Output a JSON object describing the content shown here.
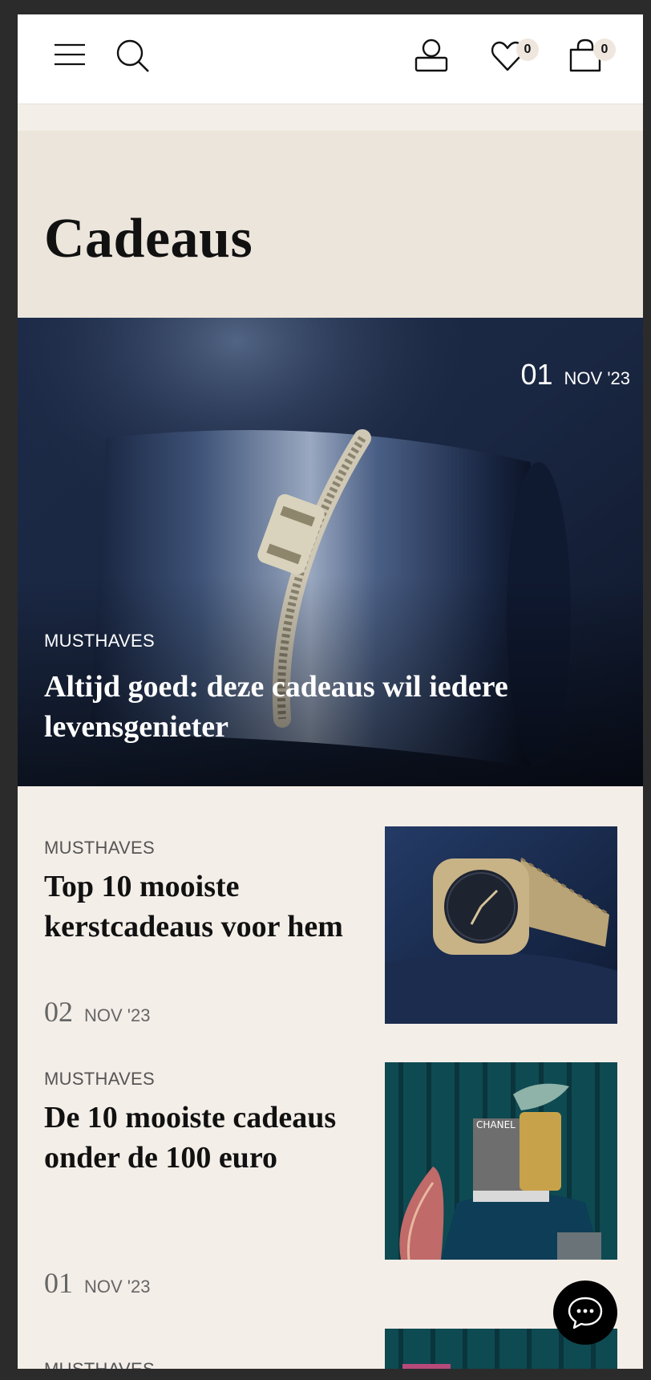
{
  "header": {
    "menu_icon": "hamburger-menu-icon",
    "search_icon": "search-icon",
    "account_icon": "user-icon",
    "wishlist_icon": "heart-icon",
    "wishlist_count": "0",
    "cart_icon": "shopping-bag-icon",
    "cart_count": "0"
  },
  "page": {
    "title": "Cadeaus"
  },
  "featured": {
    "day": "01",
    "month": "NOV '23",
    "category": "MUSTHAVES",
    "title": "Altijd goed: deze cadeaus wil iedere levensgenieter"
  },
  "articles": [
    {
      "category": "MUSTHAVES",
      "title": "Top 10 mooiste kerstcadeaus voor hem",
      "day": "02",
      "month": "NOV '23"
    },
    {
      "category": "MUSTHAVES",
      "title": "De 10 mooiste cadeaus onder de 100 euro",
      "day": "01",
      "month": "NOV '23",
      "image_text": "CHANEL"
    },
    {
      "category": "MUSTHAVES"
    }
  ],
  "chat": {
    "icon": "chat-bubble-icon"
  },
  "colors": {
    "banner_bg": "#ece5db",
    "page_bg": "#f4eee8",
    "badge_bg": "#efe7de"
  }
}
